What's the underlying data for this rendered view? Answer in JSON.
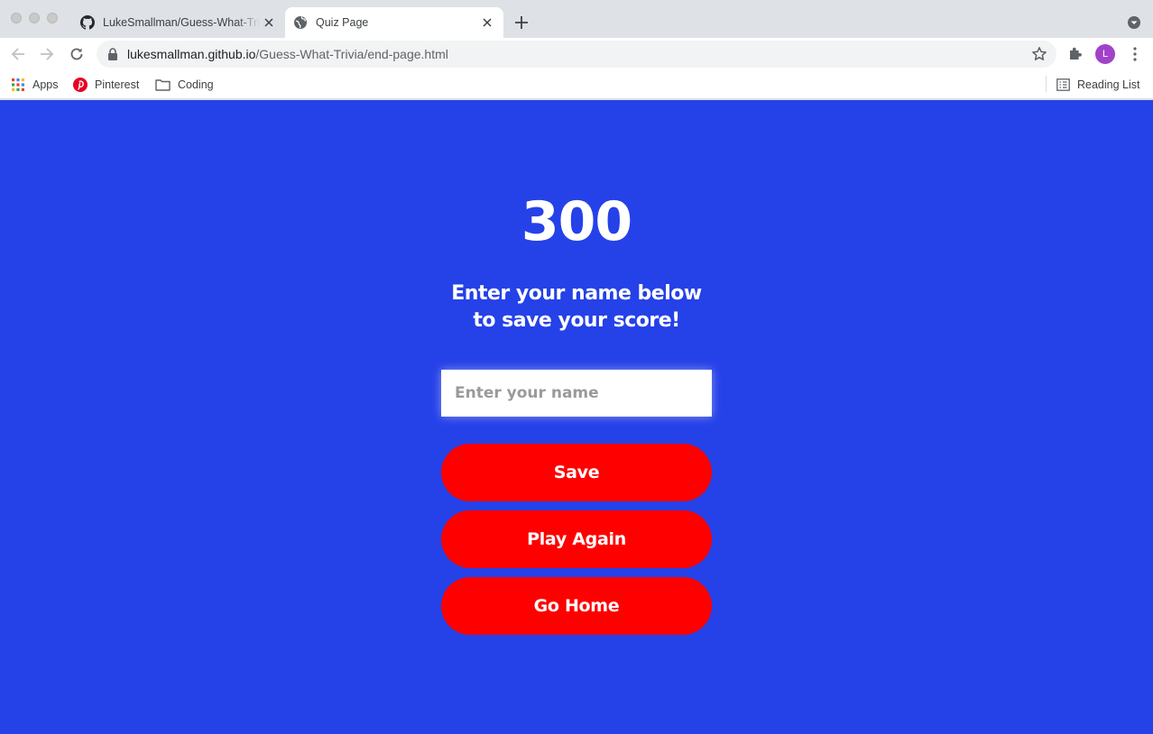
{
  "browser": {
    "tabs": [
      {
        "title": "LukeSmallman/Guess-What-Trivia",
        "active": false
      },
      {
        "title": "Quiz Page",
        "active": true
      }
    ],
    "url": {
      "host": "lukesmallman.github.io",
      "path": "/Guess-What-Trivia/end-page.html"
    },
    "profile_initial": "L",
    "profile_color": "#a142c9",
    "bookmarks": [
      {
        "label": "Apps",
        "icon": "apps-grid-icon"
      },
      {
        "label": "Pinterest",
        "icon": "pinterest-icon"
      },
      {
        "label": "Coding",
        "icon": "folder-icon"
      }
    ],
    "reading_list_label": "Reading List"
  },
  "page": {
    "background_color": "#2541e8",
    "score": "300",
    "prompt_line1": "Enter your name below",
    "prompt_line2": "to save your score!",
    "name_input": {
      "placeholder": "Enter your name",
      "value": ""
    },
    "buttons": {
      "save": "Save",
      "play_again": "Play Again",
      "go_home": "Go Home"
    },
    "button_color": "#ff0000"
  }
}
